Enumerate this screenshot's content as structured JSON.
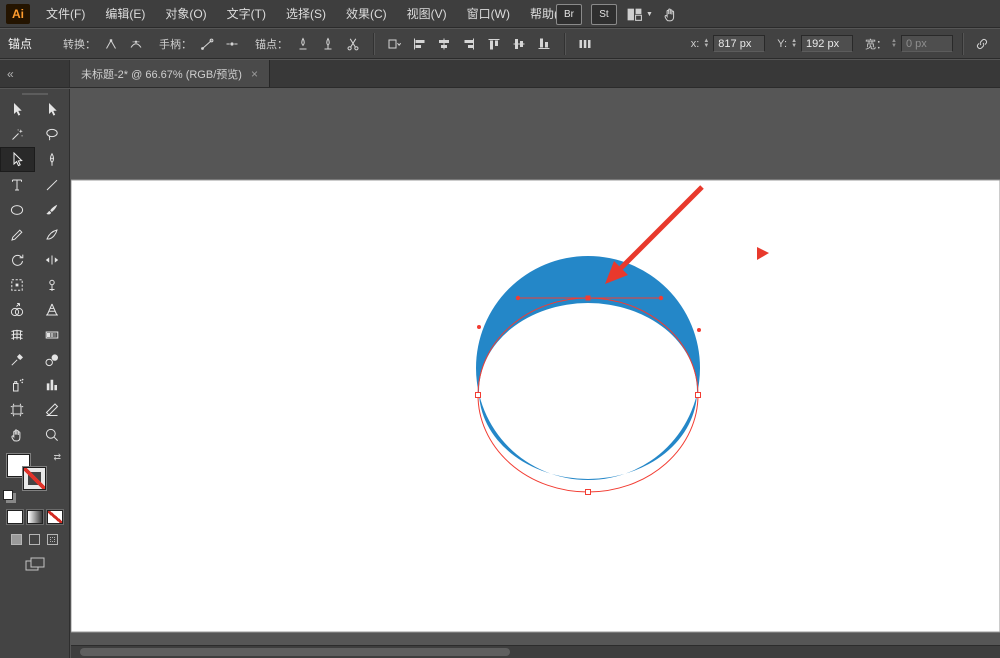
{
  "menubar": {
    "logo": "Ai",
    "items": [
      "文件(F)",
      "编辑(E)",
      "对象(O)",
      "文字(T)",
      "选择(S)",
      "效果(C)",
      "视图(V)",
      "窗口(W)",
      "帮助(H)"
    ],
    "bridge": "Br",
    "stock": "St"
  },
  "controlbar": {
    "title": "锚点",
    "convert": "转换：",
    "handles": "手柄：",
    "anchors": "锚点：",
    "x_label": "x:",
    "x_value": "817 px",
    "y_label": "Y:",
    "y_value": "192 px",
    "w_label": "宽：",
    "w_value": "0 px"
  },
  "tabbar": {
    "collapse": "«",
    "title": "未标题-2* @ 66.67% (RGB/预览)",
    "close": "×"
  },
  "toolbar": {
    "tools": [
      {
        "name": "selection-tool",
        "icon": "arrowFilled",
        "active": false
      },
      {
        "name": "group-selection-tool",
        "icon": "arrowFilled",
        "active": false
      },
      {
        "name": "magic-wand-tool",
        "icon": "wand",
        "active": false
      },
      {
        "name": "lasso-tool",
        "icon": "lasso",
        "active": false
      },
      {
        "name": "direct-selection-tool",
        "icon": "arrowOutline",
        "active": true
      },
      {
        "name": "pen-tool",
        "icon": "pen",
        "active": false
      },
      {
        "name": "type-tool",
        "icon": "type",
        "active": false
      },
      {
        "name": "line-segment-tool",
        "icon": "line",
        "active": false
      },
      {
        "name": "ellipse-tool",
        "icon": "ellipse",
        "active": false
      },
      {
        "name": "paintbrush-tool",
        "icon": "brush",
        "active": false
      },
      {
        "name": "pencil-tool",
        "icon": "pencil",
        "active": false
      },
      {
        "name": "shaper-tool",
        "icon": "shaper",
        "active": false
      },
      {
        "name": "rotate-tool",
        "icon": "rotate",
        "active": false
      },
      {
        "name": "width-tool",
        "icon": "width",
        "active": false
      },
      {
        "name": "free-transform-tool",
        "icon": "freeTransform",
        "active": false
      },
      {
        "name": "puppet-warp-tool",
        "icon": "pin",
        "active": false
      },
      {
        "name": "shape-builder-tool",
        "icon": "shapeBuilder",
        "active": false
      },
      {
        "name": "perspective-grid-tool",
        "icon": "perspective",
        "active": false
      },
      {
        "name": "mesh-tool",
        "icon": "mesh",
        "active": false
      },
      {
        "name": "gradient-tool",
        "icon": "gradient",
        "active": false
      },
      {
        "name": "eyedropper-tool",
        "icon": "eyedropper",
        "active": false
      },
      {
        "name": "blend-tool",
        "icon": "blend",
        "active": false
      },
      {
        "name": "symbol-sprayer-tool",
        "icon": "spray",
        "active": false
      },
      {
        "name": "column-graph-tool",
        "icon": "graph",
        "active": false
      },
      {
        "name": "artboard-tool",
        "icon": "artboard",
        "active": false
      },
      {
        "name": "slice-tool",
        "icon": "slice",
        "active": false
      },
      {
        "name": "hand-tool",
        "icon": "hand",
        "active": false
      },
      {
        "name": "zoom-tool",
        "icon": "zoom",
        "active": false
      }
    ]
  },
  "canvas": {
    "shape_fill": "#2487c8",
    "selection_color": "#f23c32",
    "annotation_color": "#e8392c",
    "artboard_color": "#ffffff"
  },
  "icons": {
    "up": "▲",
    "down": "▼",
    "caret": "▼",
    "swap": "⇄"
  }
}
